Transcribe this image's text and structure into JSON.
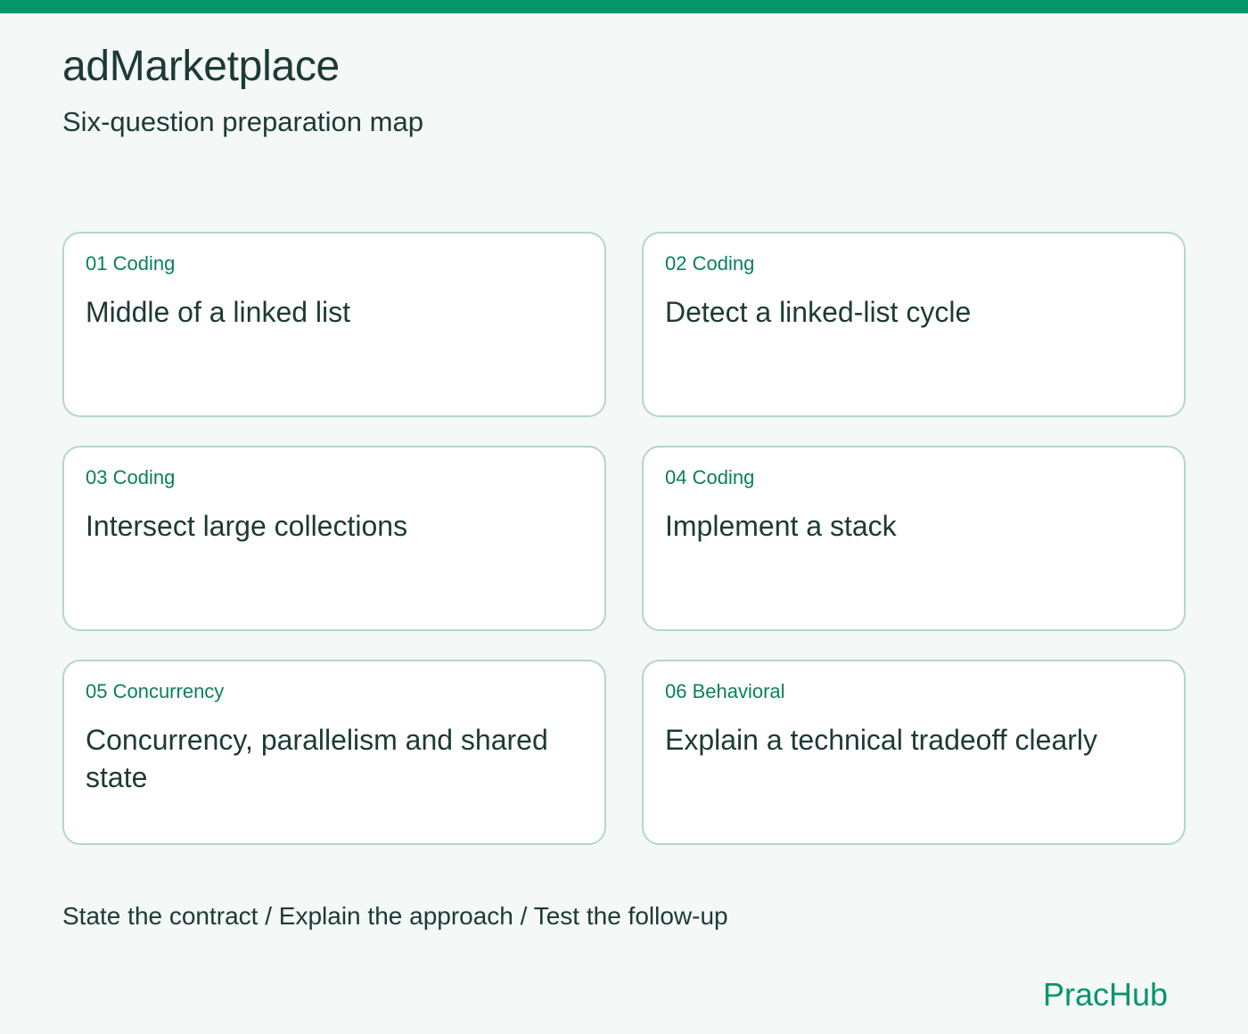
{
  "header": {
    "title": "adMarketplace",
    "subtitle": "Six-question preparation map"
  },
  "cards": [
    {
      "number": "01",
      "category": "Coding",
      "meta": "01 Coding",
      "title": "Middle of a linked list"
    },
    {
      "number": "02",
      "category": "Coding",
      "meta": "02 Coding",
      "title": "Detect a linked-list cycle"
    },
    {
      "number": "03",
      "category": "Coding",
      "meta": "03 Coding",
      "title": "Intersect large collections"
    },
    {
      "number": "04",
      "category": "Coding",
      "meta": "04 Coding",
      "title": "Implement a stack"
    },
    {
      "number": "05",
      "category": "Concurrency",
      "meta": "05 Concurrency",
      "title": "Concurrency, parallelism and shared state"
    },
    {
      "number": "06",
      "category": "Behavioral",
      "meta": "06 Behavioral",
      "title": "Explain a technical tradeoff clearly"
    }
  ],
  "footer": {
    "steps": "State the contract / Explain the approach / Test the follow-up",
    "brand": "PracHub"
  },
  "colors": {
    "accent": "#05956a",
    "text": "#1d3a34",
    "background": "#f4f8f6",
    "card_border": "#b4d6cb"
  }
}
